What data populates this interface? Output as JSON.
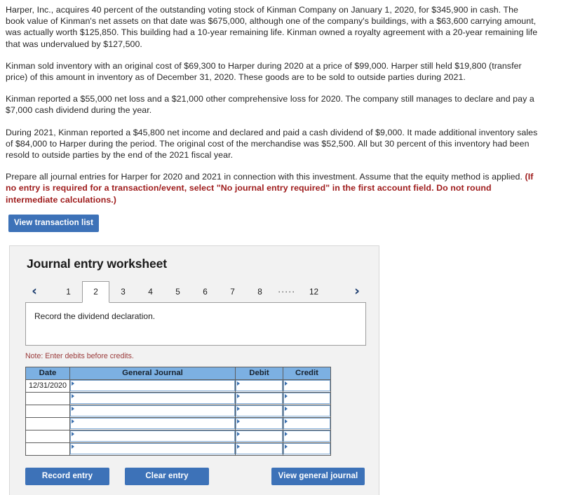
{
  "narrative": {
    "paragraphs": [
      "Harper, Inc., acquires 40 percent of the outstanding voting stock of Kinman Company on January 1, 2020, for $345,900 in cash. The book value of Kinman's net assets on that date was $675,000, although one of the company's buildings, with a $63,600 carrying amount, was actually worth $125,850. This building had a 10-year remaining life. Kinman owned a royalty agreement with a 20-year remaining life that was undervalued by $127,500.",
      "Kinman sold inventory with an original cost of $69,300 to Harper during 2020 at a price of $99,000. Harper still held $19,800 (transfer price) of this amount in inventory as of December 31, 2020. These goods are to be sold to outside parties during 2021.",
      "Kinman reported a $55,000 net loss and a $21,000 other comprehensive loss for 2020. The company still manages to declare and pay a $7,000 cash dividend during the year.",
      "During 2021, Kinman reported a $45,800 net income and declared and paid a cash dividend of $9,000. It made additional inventory sales of $84,000 to Harper during the period. The original cost of the merchandise was $52,500. All but 30 percent of this inventory had been resold to outside parties by the end of the 2021 fiscal year."
    ],
    "requirement_plain": "Prepare all journal entries for Harper for 2020 and 2021 in connection with this investment. Assume that the equity method is applied.",
    "requirement_bold": "(If no entry is required for a transaction/event, select \"No journal entry required\" in the first account field. Do not round intermediate calculations.)"
  },
  "toolbar": {
    "view_transaction_list_label": "View transaction list"
  },
  "worksheet": {
    "title": "Journal entry worksheet",
    "pager": {
      "prev_icon": "‹",
      "next_icon": "›",
      "tabs": [
        "1",
        "2",
        "3",
        "4",
        "5",
        "6",
        "7",
        "8"
      ],
      "ellipsis": ".....",
      "last_tab": "12",
      "selected": "2"
    },
    "prompt": "Record the dividend declaration.",
    "note": "Note: Enter debits before credits.",
    "table": {
      "headers": [
        "Date",
        "General Journal",
        "Debit",
        "Credit"
      ],
      "rows": [
        {
          "date": "12/31/2020",
          "general_journal": "",
          "debit": "",
          "credit": ""
        },
        {
          "date": "",
          "general_journal": "",
          "debit": "",
          "credit": ""
        },
        {
          "date": "",
          "general_journal": "",
          "debit": "",
          "credit": ""
        },
        {
          "date": "",
          "general_journal": "",
          "debit": "",
          "credit": ""
        },
        {
          "date": "",
          "general_journal": "",
          "debit": "",
          "credit": ""
        },
        {
          "date": "",
          "general_journal": "",
          "debit": "",
          "credit": ""
        }
      ]
    },
    "footer": {
      "record_entry_label": "Record entry",
      "clear_entry_label": "Clear entry",
      "view_general_journal_label": "View general journal"
    }
  },
  "colors": {
    "button_blue": "#3d72b8",
    "table_header_blue": "#7cb0e2",
    "panel_gray": "#f2f2f2",
    "note_red": "#9a3a3a",
    "requirement_red": "#9e1b1b"
  }
}
